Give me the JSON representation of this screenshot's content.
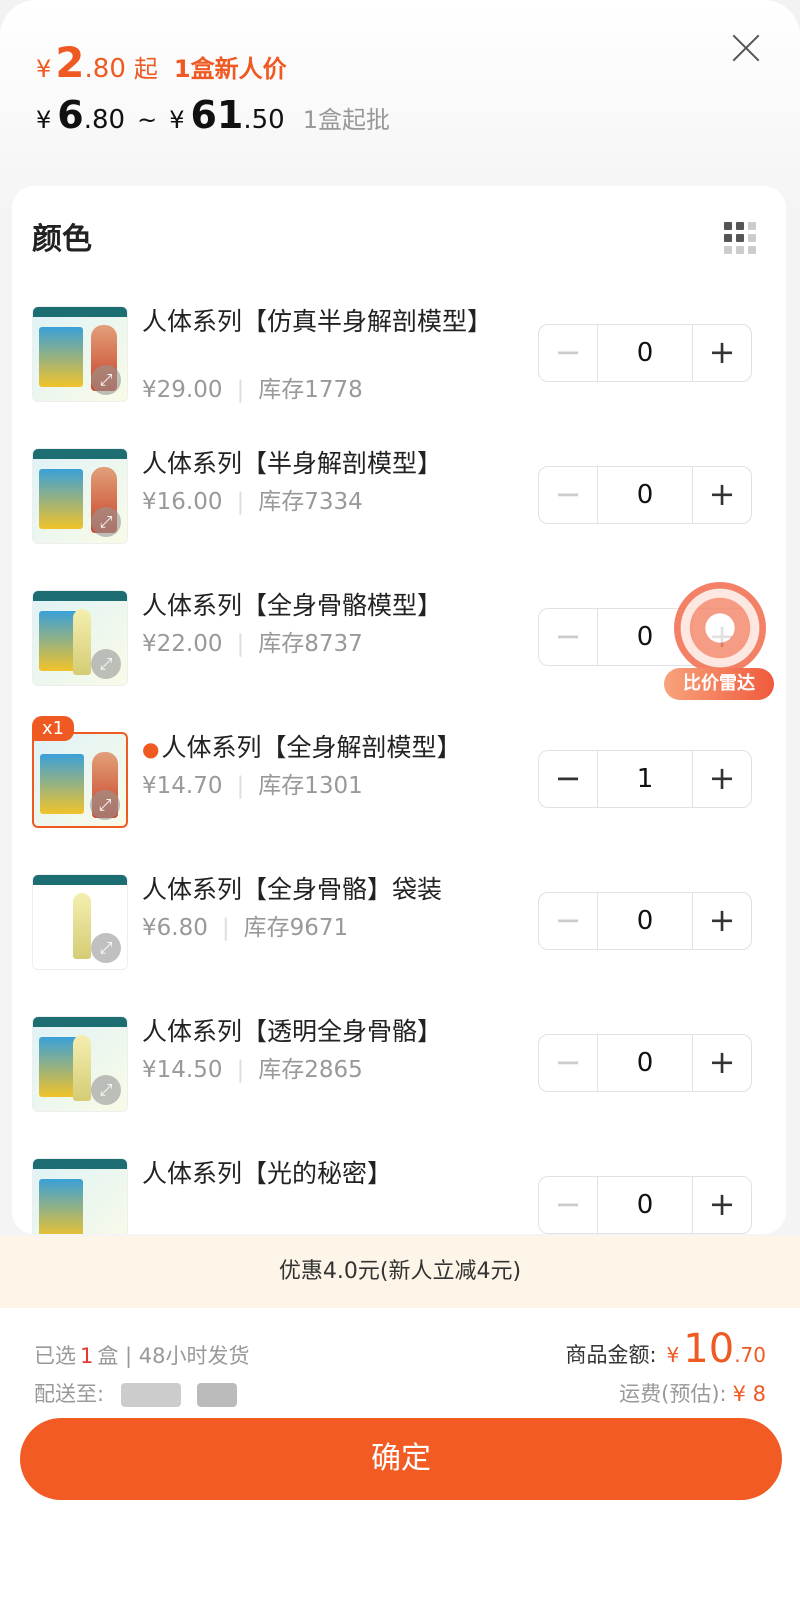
{
  "header": {
    "new_price": {
      "currency": "¥",
      "int": "2",
      "dec": ".80",
      "suffix": "起",
      "label": "1盒新人价"
    },
    "range": {
      "cur1": "¥",
      "int1": "6",
      "dec1": ".80",
      "tilde": "~",
      "cur2": "¥",
      "int2": "61",
      "dec2": ".50",
      "moq": "1盒起批"
    }
  },
  "section": {
    "title": "颜色"
  },
  "items": [
    {
      "name": "人体系列【仿真半身解剖模型】",
      "price": "¥29.00",
      "stock": "库存1778",
      "qty": "0"
    },
    {
      "name": "人体系列【半身解剖模型】",
      "price": "¥16.00",
      "stock": "库存7334",
      "qty": "0"
    },
    {
      "name": "人体系列【全身骨骼模型】",
      "price": "¥22.00",
      "stock": "库存8737",
      "qty": "0"
    },
    {
      "name": "人体系列【全身解剖模型】",
      "price": "¥14.70",
      "stock": "库存1301",
      "qty": "1",
      "badge": "x1"
    },
    {
      "name": "人体系列【全身骨骼】袋装",
      "price": "¥6.80",
      "stock": "库存9671",
      "qty": "0"
    },
    {
      "name": "人体系列【透明全身骨骼】",
      "price": "¥14.50",
      "stock": "库存2865",
      "qty": "0"
    },
    {
      "name": "人体系列【光的秘密】",
      "price": "",
      "stock": "",
      "qty": "0"
    }
  ],
  "stepper": {
    "minus": "−",
    "plus": "+"
  },
  "radar": {
    "label": "比价雷达"
  },
  "promo": {
    "text": "优惠4.0元(新人立减4元)"
  },
  "footer": {
    "selected_prefix": "已选",
    "selected_count": "1",
    "selected_suffix": "盒 | 48小时发货",
    "ship_to": "配送至:",
    "total_label": "商品金额:",
    "total_currency": "¥",
    "total_int": "10",
    "total_dec": ".70",
    "freight_label": "运费(预估):",
    "freight_value": "¥ 8",
    "confirm": "确定"
  },
  "colors": {
    "accent": "#f25b24",
    "promo_bg": "#fdf6e8"
  }
}
